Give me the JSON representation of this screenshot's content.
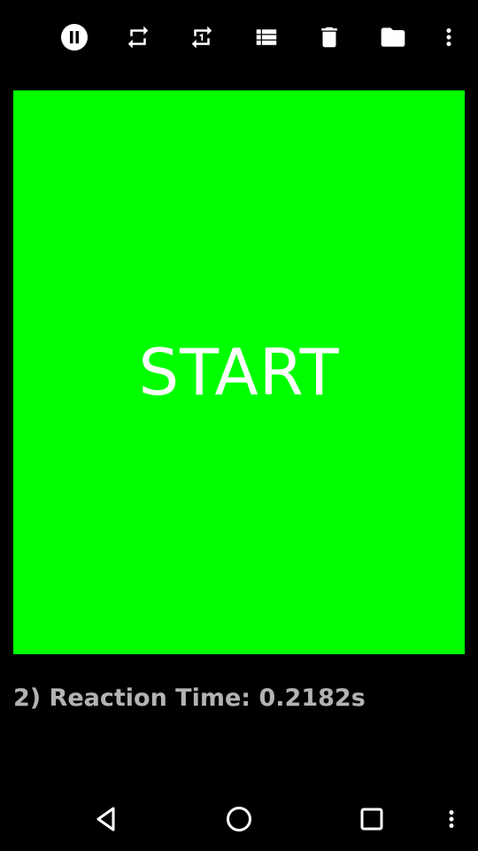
{
  "toolbar": {
    "icons": [
      "pause-icon",
      "repeat-icon",
      "repeat-one-icon",
      "list-icon",
      "delete-icon",
      "folder-icon",
      "more-vert-icon"
    ]
  },
  "main": {
    "start_label": "START",
    "background_color": "#00FF00",
    "result_text": "2) Reaction Time: 0.2182s"
  },
  "navbar": {
    "icons": [
      "back-icon",
      "home-icon",
      "recents-icon",
      "more-vert-icon"
    ]
  },
  "colors": {
    "background": "#000000",
    "start_area": "#00FF00",
    "start_text": "#FFFFFF",
    "result_text": "#B3B3B3",
    "icons": "#FFFFFF"
  }
}
